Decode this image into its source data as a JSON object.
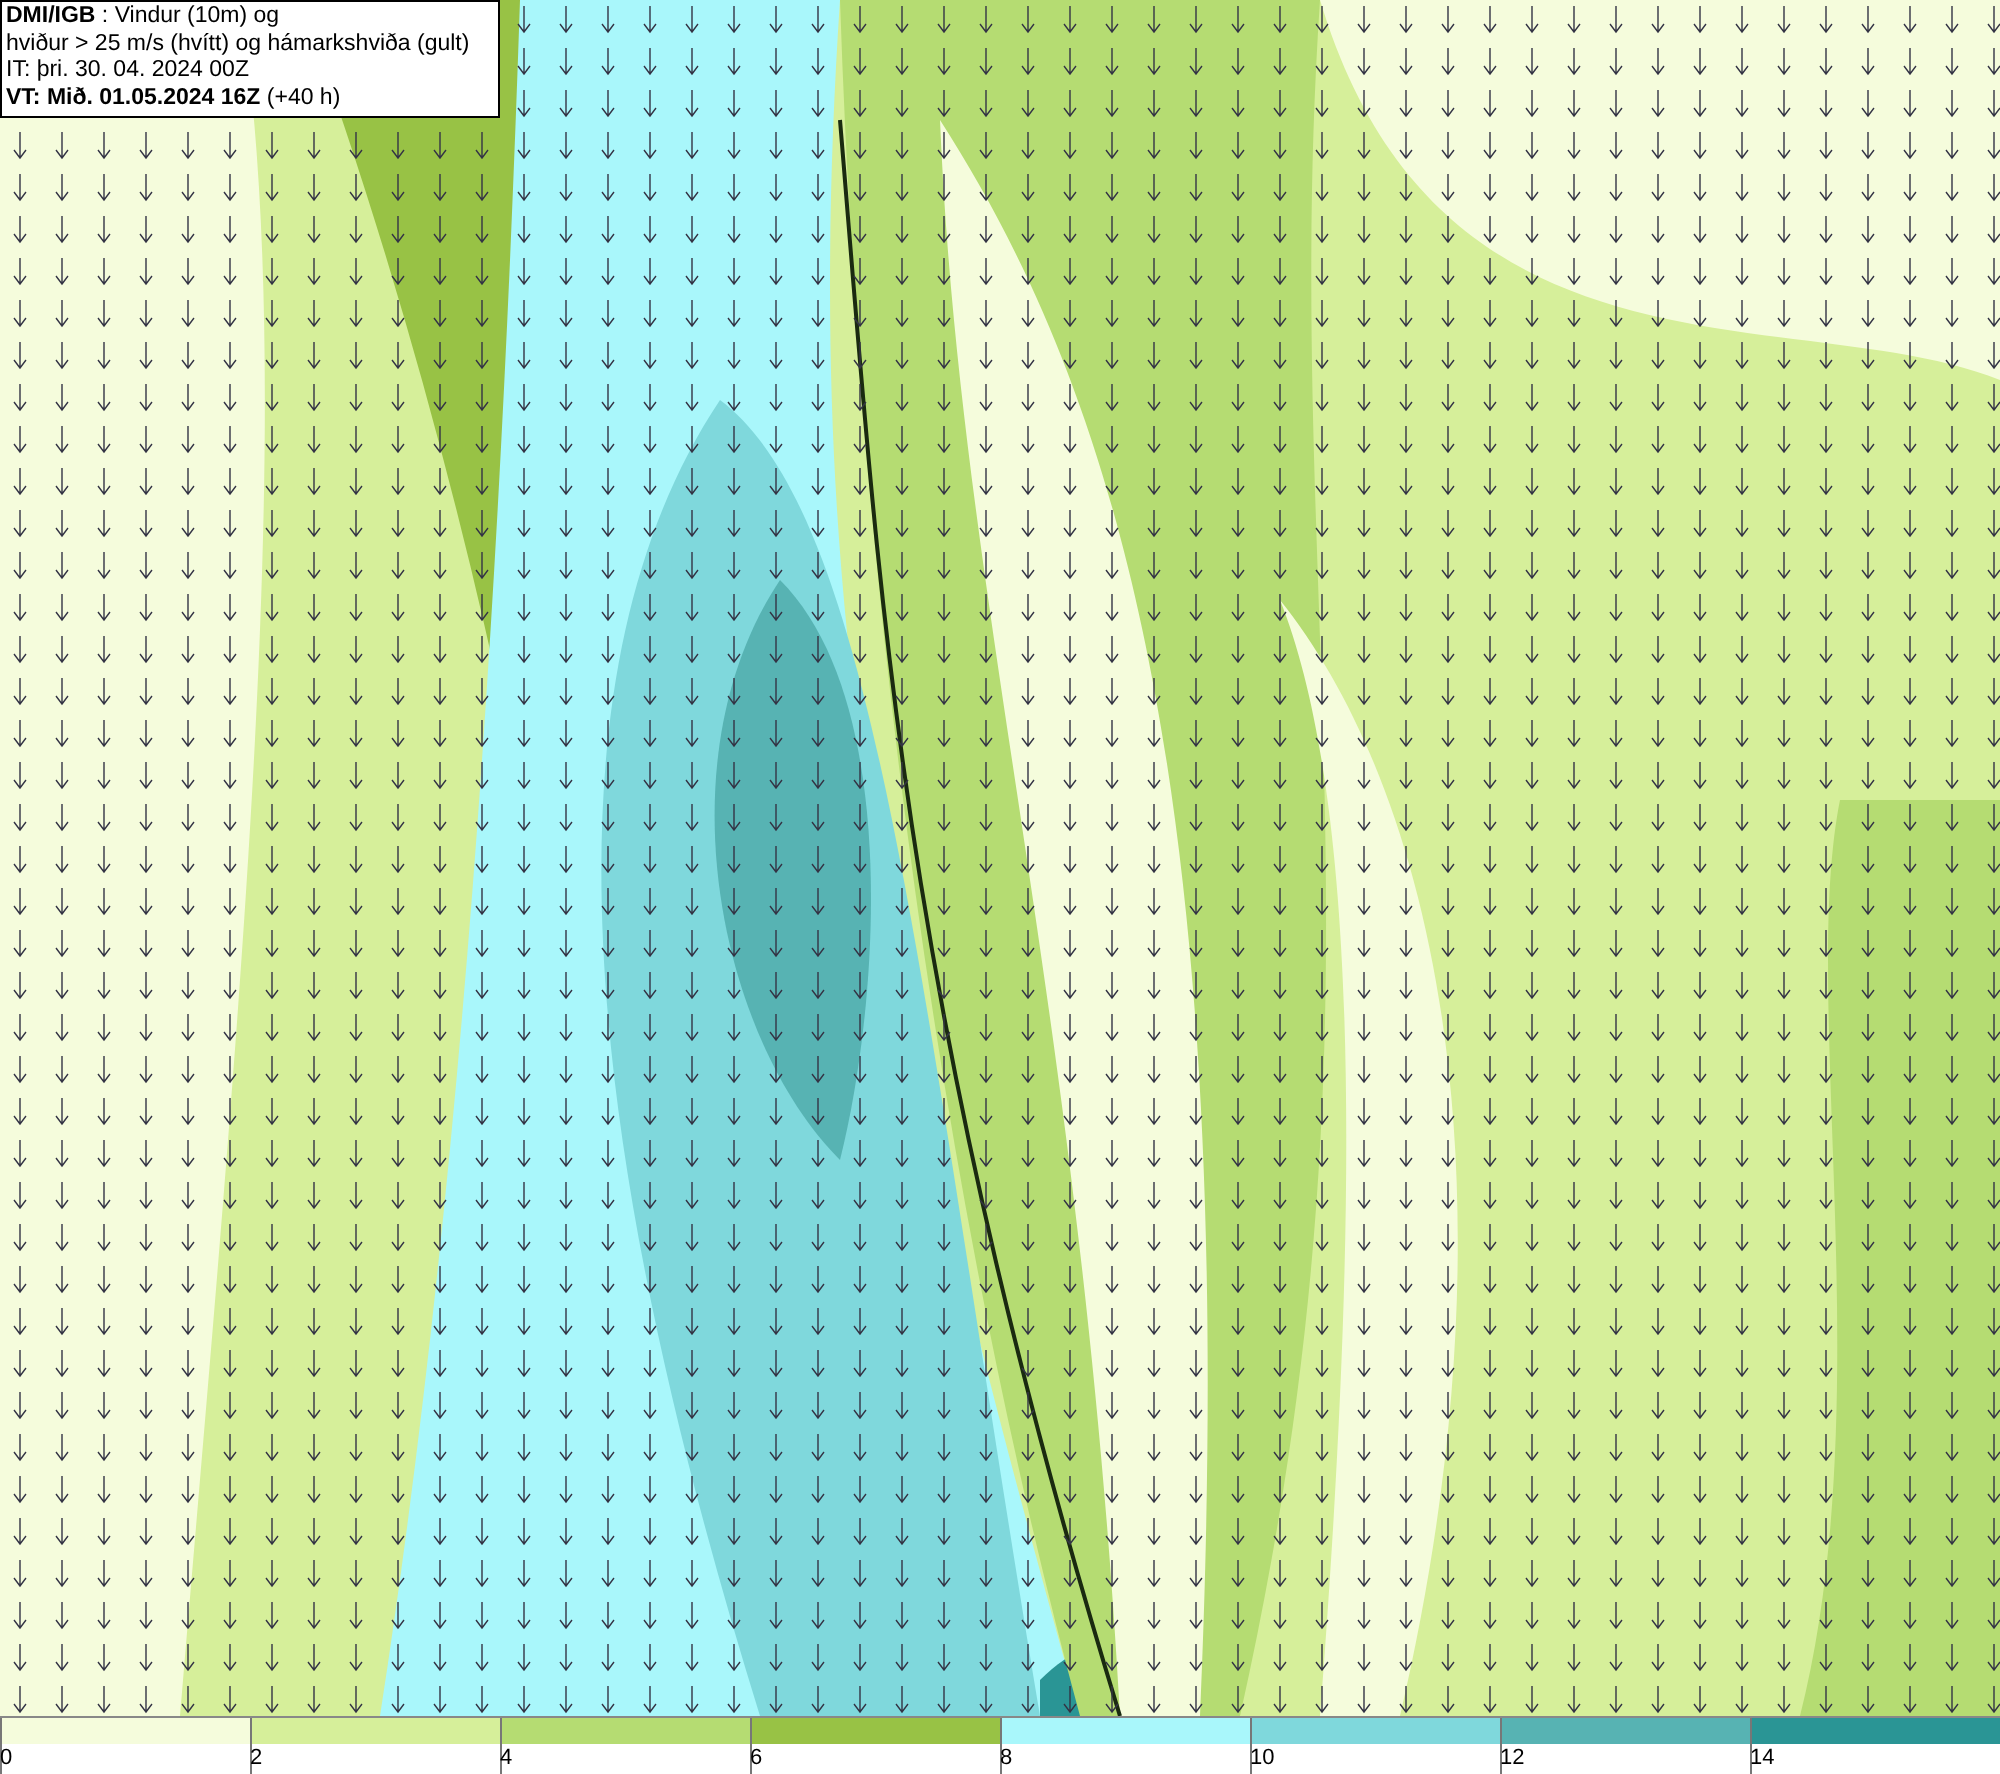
{
  "header": {
    "lines": [
      "**DMI/IGB** : Vindur (10m) og",
      "hviður > 25 m/s (hvítt) og hámarkshviða (gult)",
      "IT: þri. 30. 04. 2024 00Z",
      "**VT: Mið. 01.05.2024 16Z** (+40 h)"
    ]
  },
  "legend": [
    {
      "label": "0",
      "color": "#f5fcdc"
    },
    {
      "label": "2",
      "color": "#d6ef9a"
    },
    {
      "label": "4",
      "color": "#b5dc72"
    },
    {
      "label": "6",
      "color": "#98c245"
    },
    {
      "label": "8",
      "color": "#a9f7fb"
    },
    {
      "label": "10",
      "color": "#7fd8dc"
    },
    {
      "label": "12",
      "color": "#57b3b3"
    },
    {
      "label": "14",
      "color": "#2a9595"
    }
  ]
}
